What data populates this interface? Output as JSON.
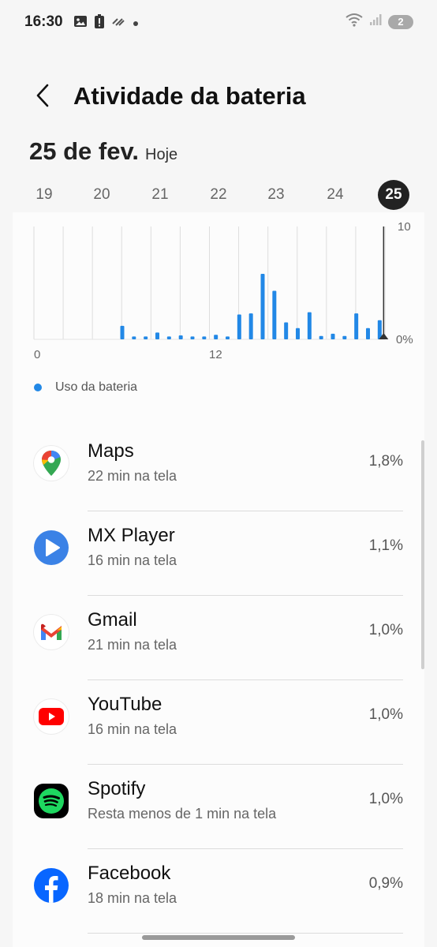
{
  "status_bar": {
    "time": "16:30",
    "notification_icons": [
      "gallery-icon",
      "battery-alert-icon",
      "data-saver-icon",
      "dot-icon"
    ],
    "right_icons": [
      "wifi-icon",
      "signal-icon"
    ],
    "badge": "2"
  },
  "header": {
    "back_icon": "chevron-left-icon",
    "title": "Atividade da bateria"
  },
  "date": {
    "main": "25 de fev.",
    "sub": "Hoje"
  },
  "days": [
    "19",
    "20",
    "21",
    "22",
    "23",
    "24",
    "25"
  ],
  "selected_day": "25",
  "chart_data": {
    "type": "bar",
    "ylim": [
      0,
      10
    ],
    "ytick_labels": [
      "10",
      "0%"
    ],
    "xtick_labels": [
      "0",
      "12"
    ],
    "series": [
      {
        "name": "Uso da bateria",
        "color": "#2288e6",
        "values": [
          1.2,
          0.25,
          0.25,
          0.6,
          0.25,
          0.35,
          0.25,
          0.25,
          0.4,
          0.25,
          2.2,
          2.3,
          5.8,
          4.3,
          1.5,
          1.0,
          2.4,
          0.3,
          0.5,
          0.3,
          2.3,
          1.0,
          1.7
        ]
      }
    ],
    "current_marker": "now",
    "grid": true
  },
  "legend": {
    "label": "Uso da bateria",
    "color": "#2288e6"
  },
  "apps": [
    {
      "name": "Maps",
      "sub": "22 min na tela",
      "percent": "1,8%",
      "icon": "google-maps-icon"
    },
    {
      "name": "MX Player",
      "sub": "16 min na tela",
      "percent": "1,1%",
      "icon": "mx-player-icon"
    },
    {
      "name": "Gmail",
      "sub": "21 min na tela",
      "percent": "1,0%",
      "icon": "gmail-icon"
    },
    {
      "name": "YouTube",
      "sub": "16 min na tela",
      "percent": "1,0%",
      "icon": "youtube-icon"
    },
    {
      "name": "Spotify",
      "sub": "Resta menos de 1 min na tela",
      "percent": "1,0%",
      "icon": "spotify-icon"
    },
    {
      "name": "Facebook",
      "sub": "18 min na tela",
      "percent": "0,9%",
      "icon": "facebook-icon"
    }
  ]
}
